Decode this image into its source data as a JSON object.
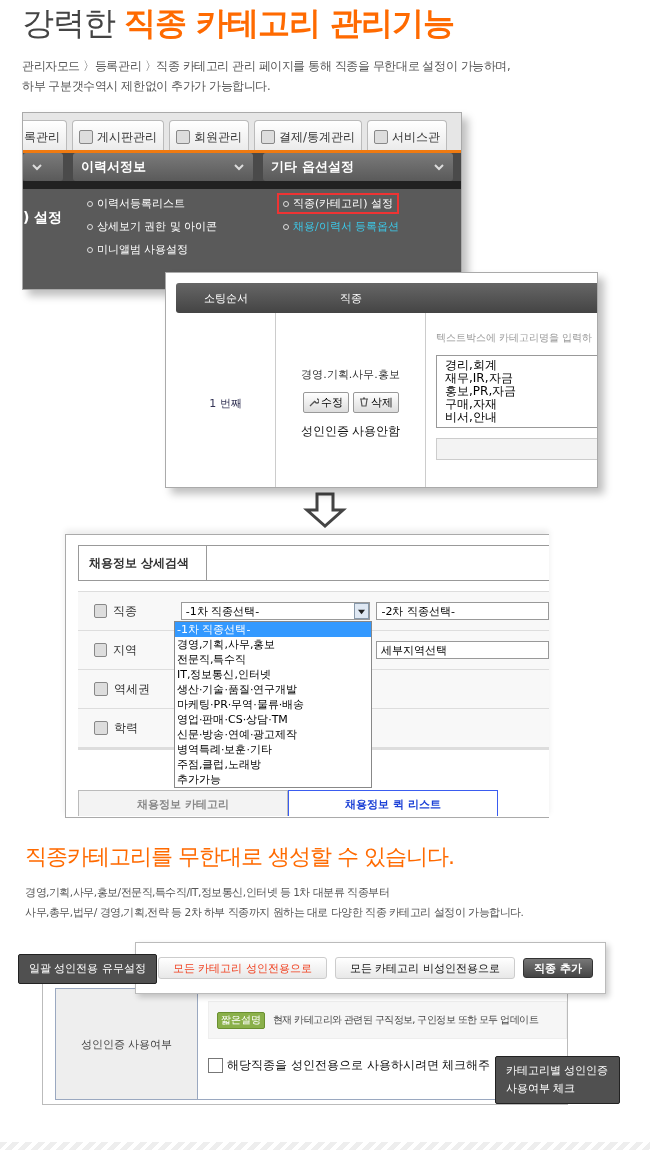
{
  "title": {
    "lead": "강력한",
    "highlight": "직종 카테고리 관리기능"
  },
  "intro": [
    "관리자모드 〉등록관리 〉직종 카테고리 관리 페이지를 통해 직종을 무한대로 설정이 가능하며,",
    "하부 구분갯수역시 제한없이 추가가 가능합니다."
  ],
  "admin_menu": {
    "tabs": [
      "록관리",
      "게시판관리",
      "회원관리",
      "결제/통계관리",
      "서비스관"
    ],
    "dropdowns": [
      "이력서정보",
      "기타 옵션설정"
    ],
    "left_label": ") 설정",
    "resume_links": [
      "이력서등록리스트",
      "상세보기 권한 및 아이콘",
      "미니앨범 사용설정"
    ],
    "option_links": [
      {
        "label": "직종(카테고리) 설정",
        "highlighted": true
      },
      {
        "label": "채용/이력서 등록옵션",
        "highlighted": false
      }
    ]
  },
  "category_table": {
    "columns": [
      "소팅순서",
      "직종"
    ],
    "order": "1 번째",
    "name": "경영.기획.사무.홍보",
    "buttons": [
      "수정",
      "삭제"
    ],
    "adult_status": "성인인증 사용안함",
    "hint": "텍스트박스에 카테고리명을 입력하",
    "subcategories": [
      "경리,회계",
      "재무,IR,자금",
      "홍보,PR,자금",
      "구매,자재",
      "비서,안내"
    ]
  },
  "search_panel": {
    "title": "채용정보 상세검색",
    "rows": [
      {
        "label": "직종",
        "first_select": "-1차 직종선택-",
        "second_select": "-2차 직종선택-"
      },
      {
        "label": "지역",
        "second_select": "세부지역선택"
      },
      {
        "label": "역세권"
      },
      {
        "label": "학력"
      }
    ],
    "dropdown_options": [
      {
        "label": "-1차 직종선택-",
        "selected": true
      },
      {
        "label": "경영,기획,사무,홍보",
        "selected": false
      },
      {
        "label": "전문직,특수직",
        "selected": false
      },
      {
        "label": "IT,정보통신,인터넷",
        "selected": false
      },
      {
        "label": "생산·기술·품질·연구개발",
        "selected": false
      },
      {
        "label": "마케팅·PR·무역·물류·배송",
        "selected": false
      },
      {
        "label": "영업·판매·CS·상담·TM",
        "selected": false
      },
      {
        "label": "신문·방송·연예·광고제작",
        "selected": false
      },
      {
        "label": "병역특례·보훈·기타",
        "selected": false
      },
      {
        "label": "주점,클럽,노래방",
        "selected": false
      },
      {
        "label": "추가가능",
        "selected": false
      }
    ],
    "tabs": [
      {
        "label": "채용정보 카테고리",
        "selected": false
      },
      {
        "label": "채용정보 퀵 리스트",
        "selected": true
      }
    ]
  },
  "section2": {
    "heading": "직종카테고리를 무한대로 생성할 수 있습니다.",
    "description": [
      "경영,기획,사무,홍보/전문직,특수직/IT,정보통신,인터넷 등 1차 대분류 직종부터",
      "사무,총무,법무/ 경영,기획,전략 등 2차 하부 직종까지 원하는 대로 다양한 직종 카테고리 설정이 가능합니다."
    ]
  },
  "adult_settings": {
    "buttons": [
      {
        "label": "모든 카테고리 성인전용으로",
        "kind": "alert"
      },
      {
        "label": "모든 카테고리 비성인전용으로",
        "kind": "plain"
      },
      {
        "label": "직종 추가",
        "kind": "dark"
      }
    ],
    "row_label": "성인인증 사용여부",
    "badge": "짧은설명",
    "note": "현재 카테고리와 관련된 구직정보, 구인정보 또한 모두 업데이트",
    "checkbox": {
      "label": "해당직종을 성인전용으로 사용하시려면 체크해주",
      "checked": false
    },
    "tooltips": [
      "일괄 성인전용 유무설정",
      "카테고리별 성인인증\n사용여부 체크"
    ]
  }
}
